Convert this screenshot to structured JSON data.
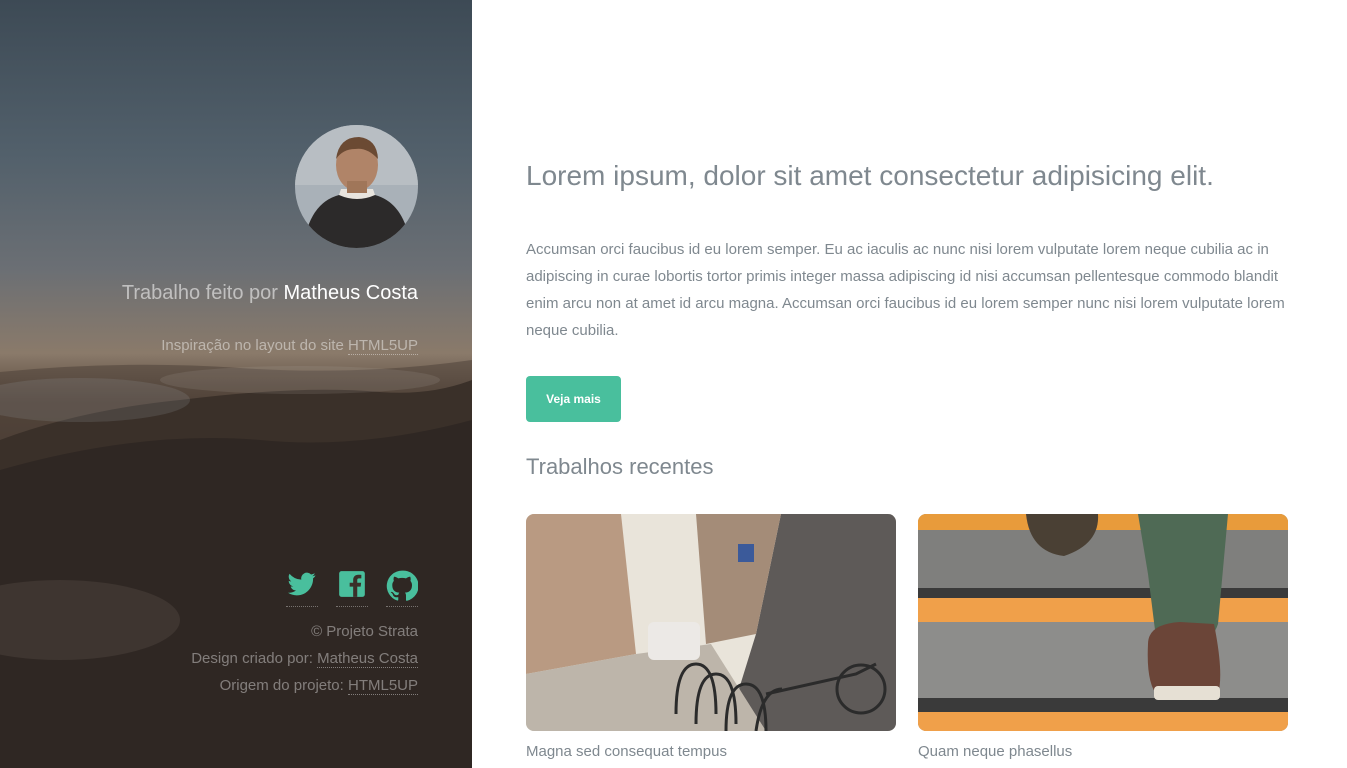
{
  "sidebar": {
    "intro_prefix": "Trabalho feito por",
    "intro_name": "Matheus Costa",
    "credit_prefix": "Inspiração no layout do site",
    "credit_link": "HTML5UP",
    "social": [
      "twitter-icon",
      "facebook-icon",
      "github-icon"
    ],
    "footer": {
      "copyright": "© Projeto Strata",
      "design_prefix": "Design criado por:",
      "design_name": "Matheus Costa",
      "origin_prefix": "Origem do projeto:",
      "origin_link": "HTML5UP"
    }
  },
  "main": {
    "headline": "Lorem ipsum, dolor sit amet consectetur adipisicing elit.",
    "lead": "Accumsan orci faucibus id eu lorem semper. Eu ac iaculis ac nunc nisi lorem vulputate lorem neque cubilia ac in adipiscing in curae lobortis tortor primis integer massa adipiscing id nisi accumsan pellentesque commodo blandit enim arcu non at amet id arcu magna. Accumsan orci faucibus id eu lorem semper nunc nisi lorem vulputate lorem neque cubilia.",
    "cta_label": "Veja mais",
    "section_title": "Trabalhos recentes",
    "works": [
      {
        "title": "Magna sed consequat tempus"
      },
      {
        "title": "Quam neque phasellus"
      }
    ]
  },
  "colors": {
    "accent": "#49bf9d",
    "text": "#7f888f"
  }
}
